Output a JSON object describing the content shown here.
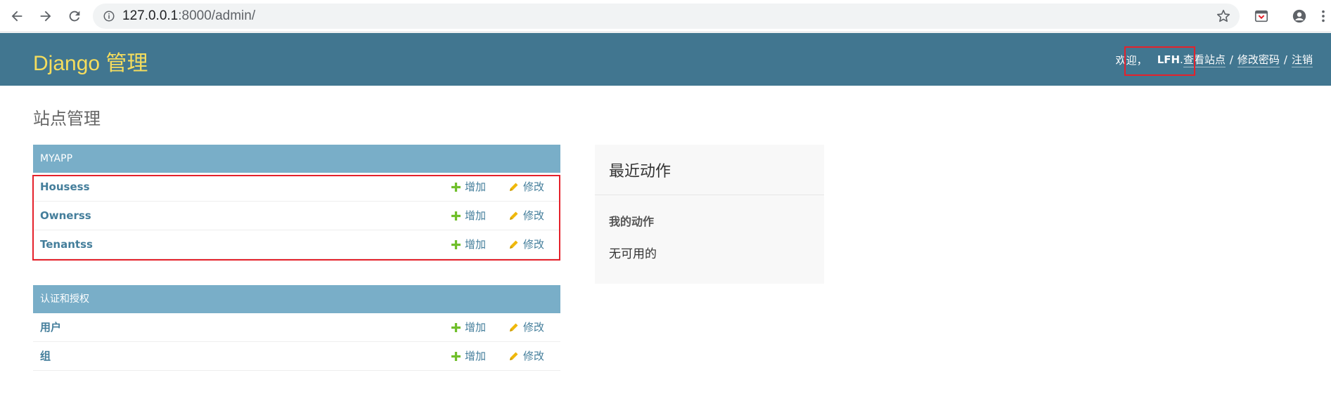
{
  "browser": {
    "url_host": "127.0.0.1",
    "url_rest": ":8000/admin/"
  },
  "header": {
    "branding": "Django 管理",
    "welcome": "欢迎，",
    "username": "LFH",
    "username_suffix": ".",
    "view_site": "查看站点",
    "separator": "/",
    "change_password": "修改密码",
    "logout": "注销"
  },
  "page_title": "站点管理",
  "modules": [
    {
      "caption": "MYAPP",
      "models": [
        {
          "name": "Housess",
          "add": "增加",
          "change": "修改"
        },
        {
          "name": "Ownerss",
          "add": "增加",
          "change": "修改"
        },
        {
          "name": "Tenantss",
          "add": "增加",
          "change": "修改"
        }
      ]
    },
    {
      "caption": "认证和授权",
      "models": [
        {
          "name": "用户",
          "add": "增加",
          "change": "修改"
        },
        {
          "name": "组",
          "add": "增加",
          "change": "修改"
        }
      ]
    }
  ],
  "recent_actions": {
    "title": "最近动作",
    "subtitle": "我的动作",
    "empty": "无可用的"
  },
  "colors": {
    "header_bg": "#417690",
    "branding": "#f5dd5d",
    "caption_bg": "#79aec8",
    "link": "#447e9b",
    "add_icon": "#70bf2b",
    "change_icon": "#efb80b",
    "highlight": "#e5212b"
  }
}
